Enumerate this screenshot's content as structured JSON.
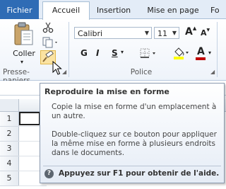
{
  "tabs": [
    {
      "label": "Fichier"
    },
    {
      "label": "Accueil"
    },
    {
      "label": "Insertion"
    },
    {
      "label": "Mise en page"
    },
    {
      "label": "Fo"
    }
  ],
  "clipboard": {
    "paste_label": "Coller",
    "group_label": "Presse-papiers"
  },
  "font": {
    "font_name": "Calibri",
    "font_size": "11",
    "bold_label": "G",
    "italic_label": "I",
    "underline_label": "S",
    "grow_label": "A",
    "shrink_label": "A",
    "font_color_label": "A",
    "group_label": "Police"
  },
  "sheet": {
    "rows": [
      "1",
      "2",
      "3",
      "4",
      "5"
    ]
  },
  "tooltip": {
    "title": "Reproduire la mise en forme",
    "para1": "Copie la mise en forme d'un emplacement à un autre.",
    "para2": "Double-cliquez sur ce bouton pour appliquer la même mise en forme à plusieurs endroits dans le documents.",
    "help": "Appuyez sur F1 pour obtenir de l'aide."
  },
  "colors": {
    "file_tab": "#2f6cb5",
    "font_color_bar": "#c00000",
    "highlight_bar": "#ffff00"
  }
}
